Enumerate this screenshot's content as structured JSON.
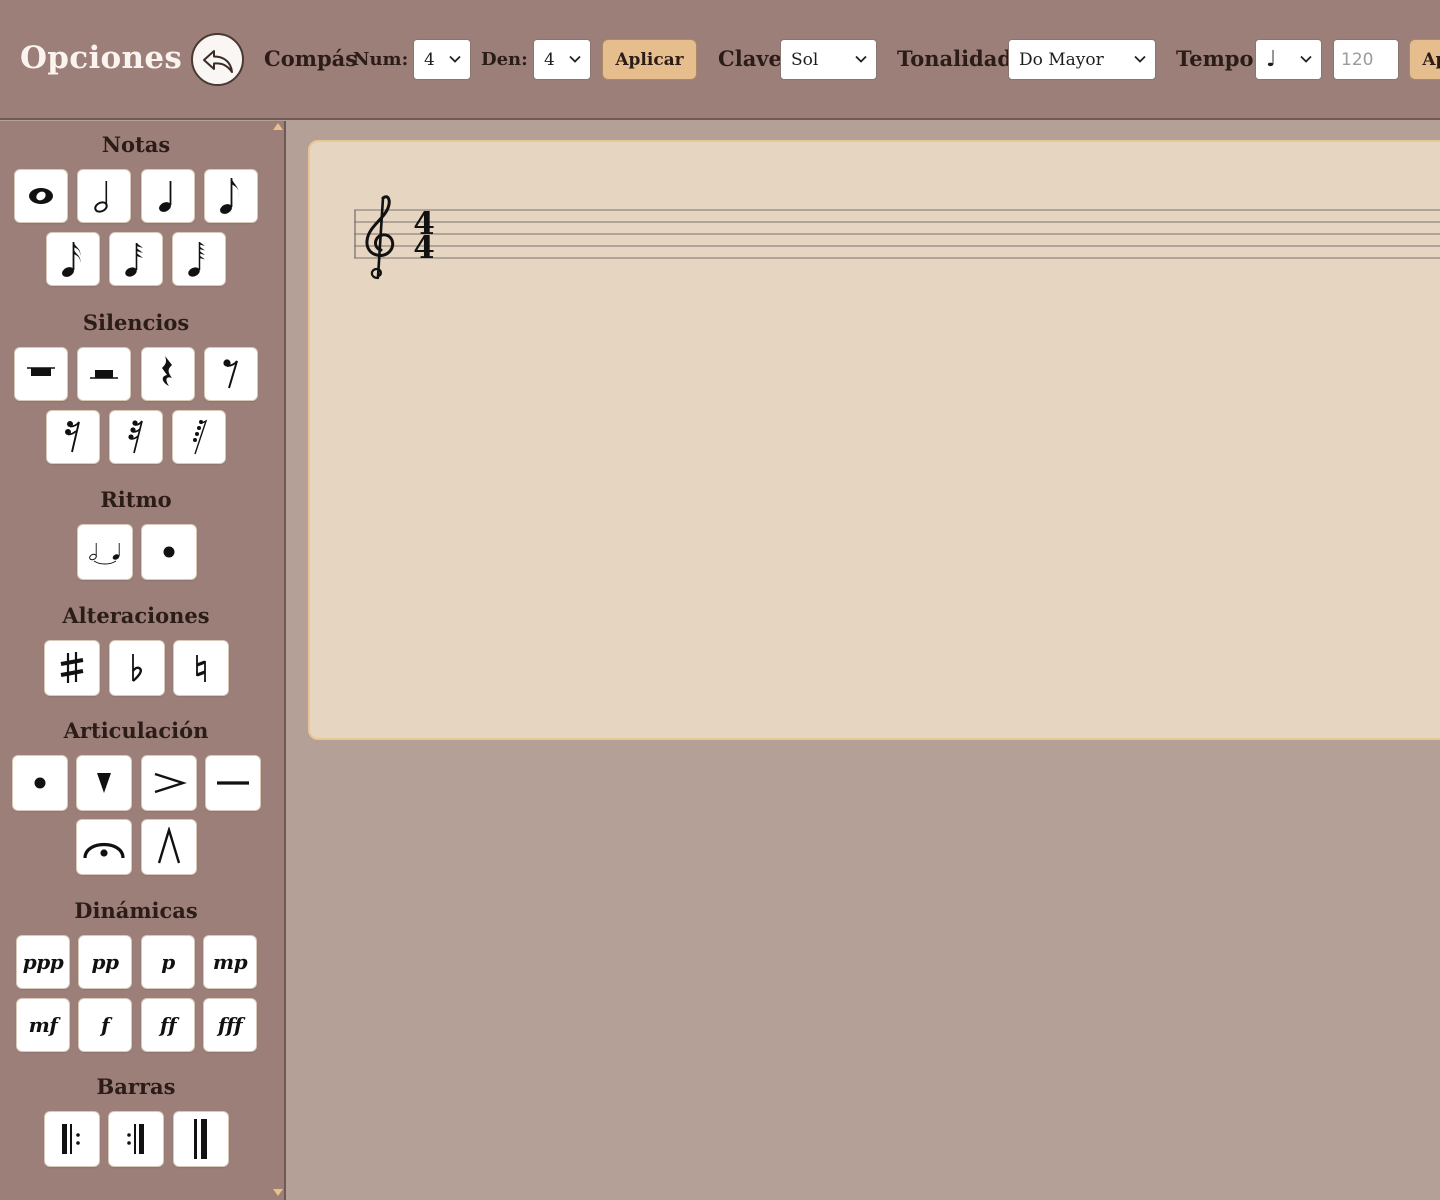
{
  "header": {
    "title": "Opciones",
    "time_signature": {
      "label": "Compás",
      "num_label": "Num:",
      "num_value": "4",
      "den_label": "Den:",
      "den_value": "4",
      "apply_label": "Aplicar"
    },
    "clef": {
      "label": "Clave",
      "value": "Sol"
    },
    "key": {
      "label": "Tonalidad",
      "value": "Do Mayor"
    },
    "tempo": {
      "label": "Tempo",
      "note_value": "♩",
      "bpm_placeholder": "120",
      "apply_label": "Aplicar"
    }
  },
  "sidebar": {
    "sections": {
      "notes": "Notas",
      "rests": "Silencios",
      "rhythm": "Ritmo",
      "accidentals": "Alteraciones",
      "articulation": "Articulación",
      "dynamics": "Dinámicas",
      "bars": "Barras"
    },
    "dynamics": [
      "ppp",
      "pp",
      "p",
      "mp",
      "mf",
      "f",
      "ff",
      "fff"
    ]
  },
  "score": {
    "clef": "treble",
    "time_signature": {
      "num": "4",
      "den": "4"
    }
  },
  "colors": {
    "panel": "#9b7f78",
    "workspace": "#b5a098",
    "paper": "#e6d5c0",
    "paper_border": "#e9c692",
    "accent_button": "#e6be8e"
  }
}
